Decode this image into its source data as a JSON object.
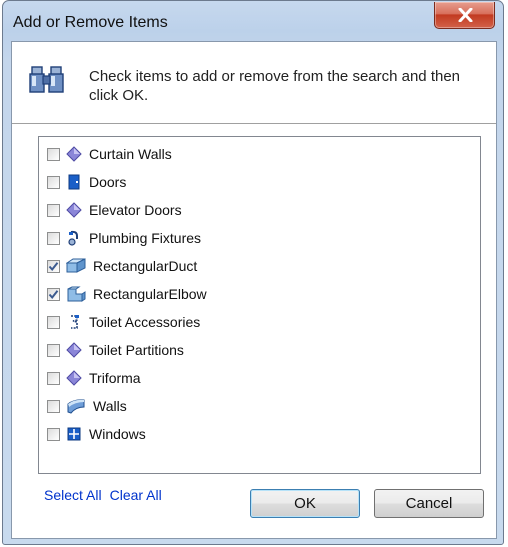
{
  "window": {
    "title": "Add or Remove Items",
    "close_label": "X"
  },
  "header": {
    "icon": "binoculars-icon",
    "instruction": "Check items to add or remove from the search and then click OK."
  },
  "items": [
    {
      "label": "Curtain Walls",
      "checked": false,
      "icon": "diamond-icon"
    },
    {
      "label": "Doors",
      "checked": false,
      "icon": "door-icon"
    },
    {
      "label": "Elevator Doors",
      "checked": false,
      "icon": "diamond-icon"
    },
    {
      "label": "Plumbing Fixtures",
      "checked": false,
      "icon": "faucet-icon"
    },
    {
      "label": "RectangularDuct",
      "checked": true,
      "icon": "duct-icon"
    },
    {
      "label": "RectangularElbow",
      "checked": true,
      "icon": "elbow-icon"
    },
    {
      "label": "Toilet Accessories",
      "checked": false,
      "icon": "accessory-icon"
    },
    {
      "label": "Toilet Partitions",
      "checked": false,
      "icon": "diamond-icon"
    },
    {
      "label": "Triforma",
      "checked": false,
      "icon": "diamond-icon"
    },
    {
      "label": "Walls",
      "checked": false,
      "icon": "wall-icon"
    },
    {
      "label": "Windows",
      "checked": false,
      "icon": "window-icon"
    }
  ],
  "footer": {
    "select_all": "Select All",
    "clear_all": "Clear All",
    "ok": "OK",
    "cancel": "Cancel"
  },
  "colors": {
    "link": "#0033cc",
    "close": "#c23a20",
    "icon_blue": "#1a5fc8",
    "icon_purple": "#8b86d8"
  }
}
